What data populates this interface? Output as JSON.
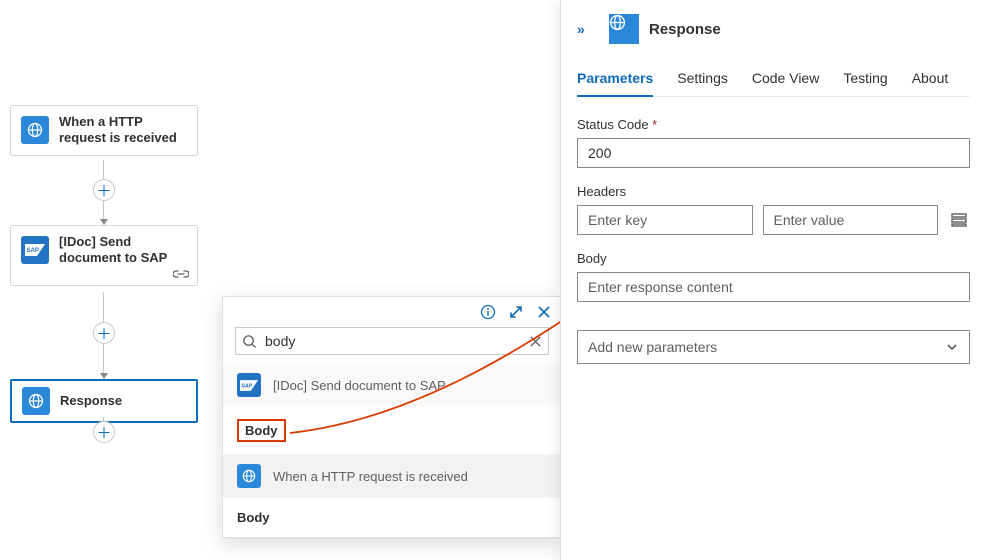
{
  "canvas": {
    "node_trigger": "When a HTTP request is received",
    "node_sap": "[IDoc] Send document to SAP",
    "node_response": "Response"
  },
  "popup": {
    "search_value": "body",
    "group_sap": "[IDoc] Send document to SAP",
    "item_body": "Body",
    "group_trigger": "When a HTTP request is received",
    "item_body2": "Body"
  },
  "panel": {
    "title": "Response",
    "tabs": {
      "parameters": "Parameters",
      "settings": "Settings",
      "code": "Code View",
      "testing": "Testing",
      "about": "About"
    },
    "fields": {
      "status_label": "Status Code",
      "status_value": "200",
      "headers_label": "Headers",
      "headers_key_ph": "Enter key",
      "headers_val_ph": "Enter value",
      "body_label": "Body",
      "body_ph": "Enter response content",
      "add_param": "Add new parameters"
    }
  }
}
